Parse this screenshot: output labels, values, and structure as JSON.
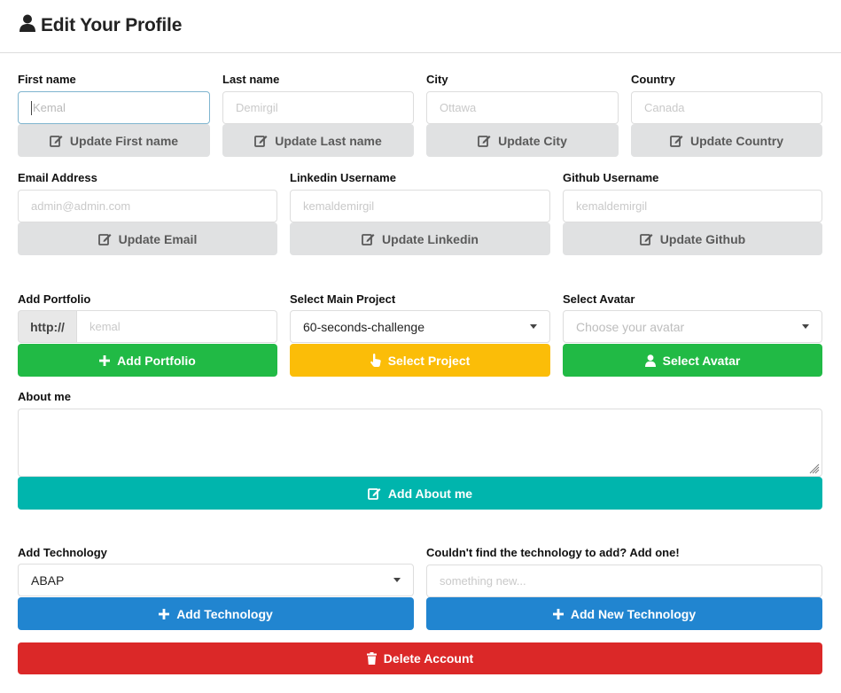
{
  "header": {
    "title": "Edit Your Profile",
    "icon": "user-icon"
  },
  "row1": {
    "first_name": {
      "label": "First name",
      "value": "",
      "placeholder": "Kemal",
      "button": "Update First name"
    },
    "last_name": {
      "label": "Last name",
      "placeholder": "Demirgil",
      "button": "Update Last name"
    },
    "city": {
      "label": "City",
      "placeholder": "Ottawa",
      "button": "Update City"
    },
    "country": {
      "label": "Country",
      "placeholder": "Canada",
      "button": "Update Country"
    }
  },
  "row2": {
    "email": {
      "label": "Email Address",
      "placeholder": "admin@admin.com",
      "button": "Update Email"
    },
    "linkedin": {
      "label": "Linkedin Username",
      "placeholder": "kemaldemirgil",
      "button": "Update Linkedin"
    },
    "github": {
      "label": "Github Username",
      "placeholder": "kemaldemirgil",
      "button": "Update Github"
    }
  },
  "row3": {
    "portfolio": {
      "label": "Add Portfolio",
      "prefix": "http://",
      "placeholder": "kemal",
      "button": "Add Portfolio"
    },
    "project": {
      "label": "Select Main Project",
      "selected": "60-seconds-challenge",
      "button": "Select Project"
    },
    "avatar": {
      "label": "Select Avatar",
      "placeholder": "Choose your avatar",
      "button": "Select Avatar"
    }
  },
  "about": {
    "label": "About me",
    "value": "",
    "button": "Add About me"
  },
  "technology": {
    "label": "Add Technology",
    "selected": "ABAP",
    "button": "Add Technology",
    "new_label": "Couldn't find the technology to add? Add one!",
    "new_placeholder": "something new...",
    "new_button": "Add New Technology"
  },
  "delete": {
    "button": "Delete Account"
  },
  "colors": {
    "green": "#21ba45",
    "yellow": "#fbbd08",
    "teal": "#00b5ad",
    "blue": "#2185d0",
    "red": "#db2828",
    "grey": "#e0e1e2"
  }
}
